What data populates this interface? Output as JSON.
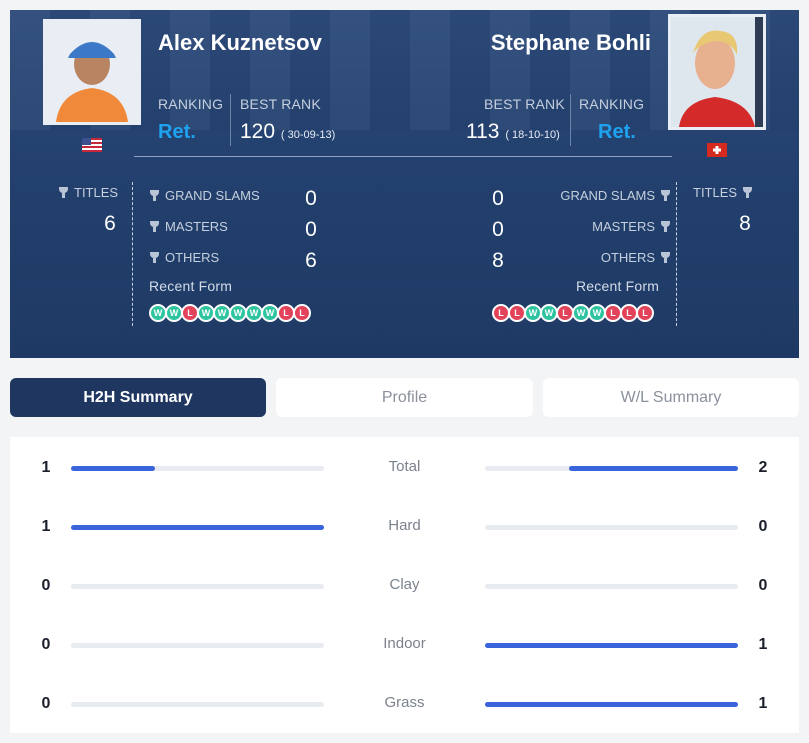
{
  "player1": {
    "name": "Alex Kuznetsov",
    "ranking_label": "RANKING",
    "ranking": "Ret.",
    "best_rank_label": "BEST RANK",
    "best_rank": "120",
    "best_rank_date": "( 30-09-13)",
    "titles_label": "TITLES",
    "titles": "6",
    "grand_slams": "0",
    "masters": "0",
    "others": "6",
    "recent_form": [
      "W",
      "W",
      "L",
      "W",
      "W",
      "W",
      "W",
      "W",
      "L",
      "L"
    ]
  },
  "player2": {
    "name": "Stephane Bohli",
    "ranking_label": "RANKING",
    "ranking": "Ret.",
    "best_rank_label": "BEST RANK",
    "best_rank": "113",
    "best_rank_date": "( 18-10-10)",
    "titles_label": "TITLES",
    "titles": "8",
    "grand_slams": "0",
    "masters": "0",
    "others": "8",
    "recent_form": [
      "L",
      "L",
      "W",
      "W",
      "L",
      "W",
      "W",
      "L",
      "L",
      "L"
    ]
  },
  "labels": {
    "grand_slams": "GRAND SLAMS",
    "masters": "MASTERS",
    "others": "OTHERS",
    "recent_form": "Recent Form"
  },
  "tabs": [
    "H2H Summary",
    "Profile",
    "W/L Summary"
  ],
  "summary": [
    {
      "label": "Total",
      "p1": "1",
      "p2": "2",
      "p1_fill": 0.333,
      "p2_fill": 0.667
    },
    {
      "label": "Hard",
      "p1": "1",
      "p2": "0",
      "p1_fill": 1,
      "p2_fill": 0
    },
    {
      "label": "Clay",
      "p1": "0",
      "p2": "0",
      "p1_fill": 0,
      "p2_fill": 0
    },
    {
      "label": "Indoor",
      "p1": "0",
      "p2": "1",
      "p1_fill": 0,
      "p2_fill": 1
    },
    {
      "label": "Grass",
      "p1": "0",
      "p2": "1",
      "p1_fill": 0,
      "p2_fill": 1
    }
  ],
  "colors": {
    "accent": "#1fa2ef",
    "win": "#2ec4a0",
    "loss": "#e2435a",
    "bar": "#3a64dc",
    "active_tab": "#1f3760"
  }
}
